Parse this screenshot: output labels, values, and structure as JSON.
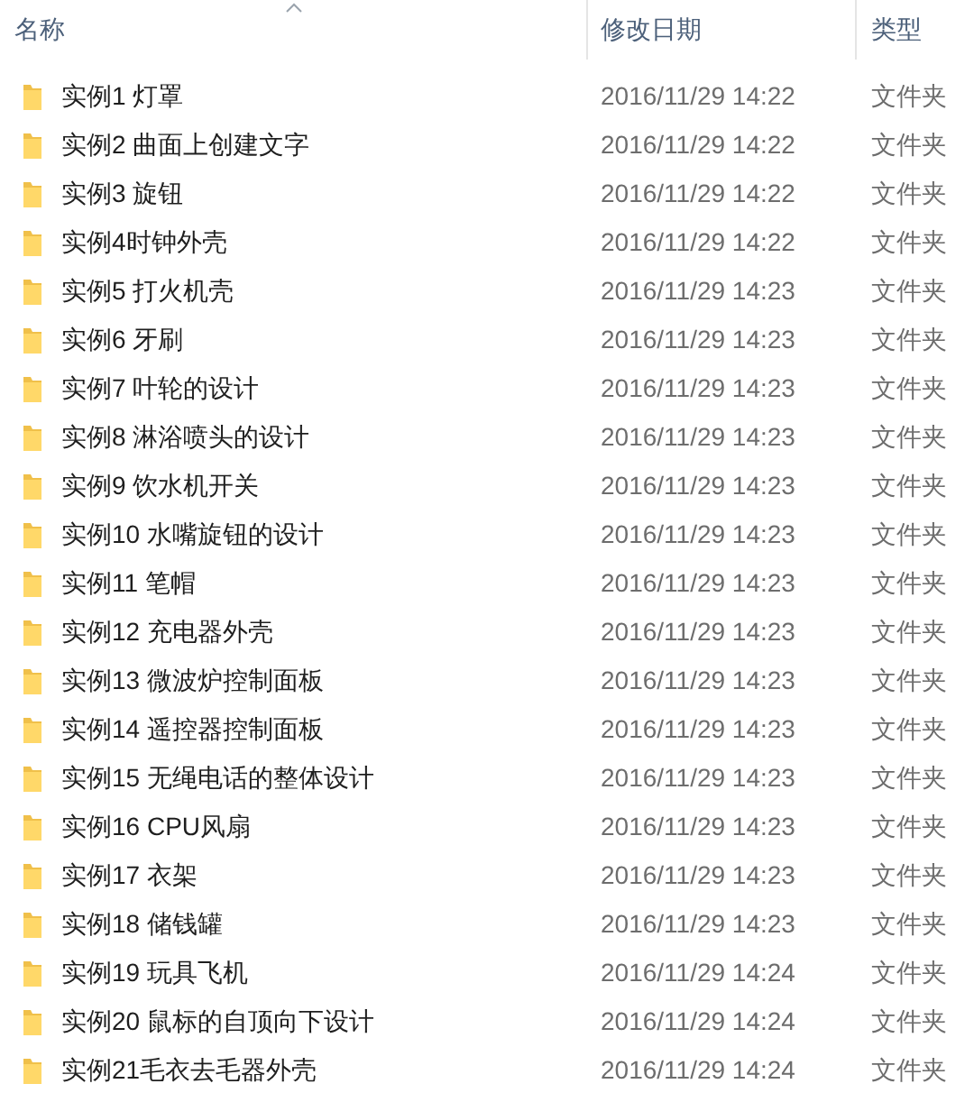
{
  "columns": [
    {
      "label": "名称",
      "sorted": true
    },
    {
      "label": "修改日期",
      "sorted": false
    },
    {
      "label": "类型",
      "sorted": false
    }
  ],
  "rows": [
    {
      "name": "实例1 灯罩",
      "modified": "2016/11/29 14:22",
      "type": "文件夹"
    },
    {
      "name": "实例2 曲面上创建文字",
      "modified": "2016/11/29 14:22",
      "type": "文件夹"
    },
    {
      "name": "实例3 旋钮",
      "modified": "2016/11/29 14:22",
      "type": "文件夹"
    },
    {
      "name": "实例4时钟外壳",
      "modified": "2016/11/29 14:22",
      "type": "文件夹"
    },
    {
      "name": "实例5 打火机壳",
      "modified": "2016/11/29 14:23",
      "type": "文件夹"
    },
    {
      "name": "实例6 牙刷",
      "modified": "2016/11/29 14:23",
      "type": "文件夹"
    },
    {
      "name": "实例7 叶轮的设计",
      "modified": "2016/11/29 14:23",
      "type": "文件夹"
    },
    {
      "name": "实例8 淋浴喷头的设计",
      "modified": "2016/11/29 14:23",
      "type": "文件夹"
    },
    {
      "name": "实例9 饮水机开关",
      "modified": "2016/11/29 14:23",
      "type": "文件夹"
    },
    {
      "name": "实例10 水嘴旋钮的设计",
      "modified": "2016/11/29 14:23",
      "type": "文件夹"
    },
    {
      "name": "实例11 笔帽",
      "modified": "2016/11/29 14:23",
      "type": "文件夹"
    },
    {
      "name": "实例12 充电器外壳",
      "modified": "2016/11/29 14:23",
      "type": "文件夹"
    },
    {
      "name": "实例13 微波炉控制面板",
      "modified": "2016/11/29 14:23",
      "type": "文件夹"
    },
    {
      "name": "实例14 遥控器控制面板",
      "modified": "2016/11/29 14:23",
      "type": "文件夹"
    },
    {
      "name": "实例15 无绳电话的整体设计",
      "modified": "2016/11/29 14:23",
      "type": "文件夹"
    },
    {
      "name": "实例16 CPU风扇",
      "modified": "2016/11/29 14:23",
      "type": "文件夹"
    },
    {
      "name": "实例17 衣架",
      "modified": "2016/11/29 14:23",
      "type": "文件夹"
    },
    {
      "name": "实例18 储钱罐",
      "modified": "2016/11/29 14:23",
      "type": "文件夹"
    },
    {
      "name": "实例19 玩具飞机",
      "modified": "2016/11/29 14:24",
      "type": "文件夹"
    },
    {
      "name": "实例20 鼠标的自顶向下设计",
      "modified": "2016/11/29 14:24",
      "type": "文件夹"
    },
    {
      "name": "实例21毛衣去毛器外壳",
      "modified": "2016/11/29 14:24",
      "type": "文件夹"
    }
  ]
}
